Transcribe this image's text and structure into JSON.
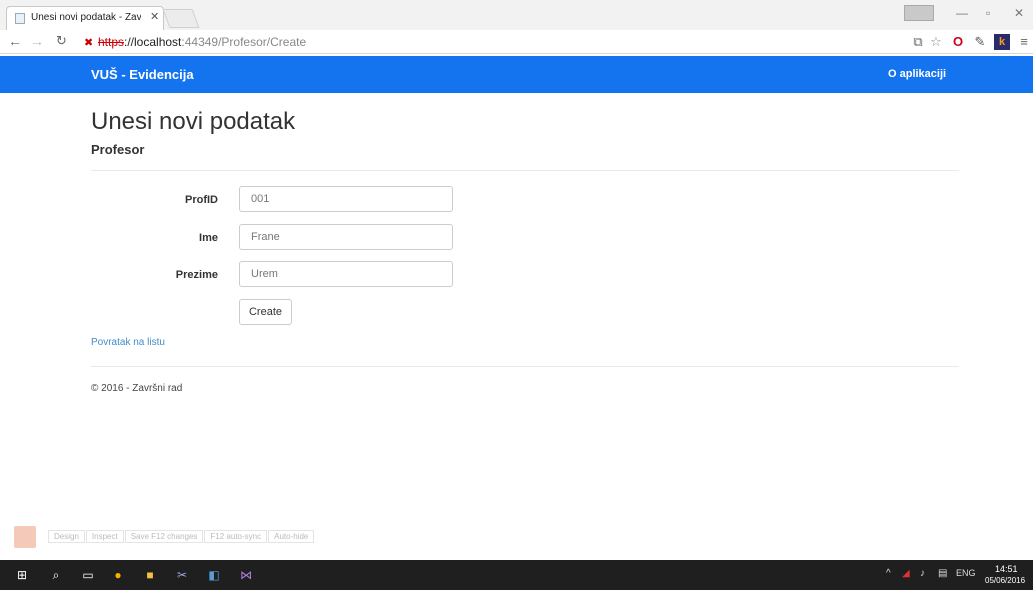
{
  "browser": {
    "tab_title": "Unesi novi podatak - Završ",
    "url_scheme": "https",
    "url_host": "://localhost",
    "url_rest": ":44349/Profesor/Create"
  },
  "navbar": {
    "brand": "VUŠ - Evidencija",
    "link": "O aplikaciji",
    "bg_color": "#1474f0"
  },
  "page": {
    "title": "Unesi novi podatak",
    "subtitle": "Profesor"
  },
  "form": {
    "fields": [
      {
        "label": "ProfID",
        "value": "001"
      },
      {
        "label": "Ime",
        "value": "Frane"
      },
      {
        "label": "Prezime",
        "value": "Urem"
      }
    ],
    "submit": "Create"
  },
  "back_link": "Povratak na listu",
  "footer": "© 2016 - Završni rad",
  "browser_link": {
    "items": [
      "Design",
      "Inspect",
      "Save F12 changes",
      "F12 auto-sync",
      "Auto-hide"
    ]
  },
  "taskbar": {
    "lang": "ENG",
    "time": "14:51",
    "date": "05/06/2016"
  }
}
